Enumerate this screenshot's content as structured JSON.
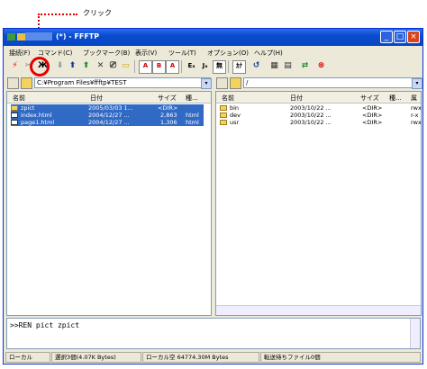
{
  "annotation": {
    "label": "クリック"
  },
  "window": {
    "title": "(*) - FFFTP",
    "title_masked": "■■■■"
  },
  "menu": [
    "接続(F)",
    "コマンド(C)",
    "ブックマーク(B)",
    "表示(V)",
    "ツール(T)",
    "オプション(O)",
    "ヘルプ(H)"
  ],
  "toolbar": [
    "connect",
    "disconnect",
    "cut",
    "download",
    "upload",
    "mirror",
    "delete",
    "rename",
    "mkdir",
    "asc",
    "bin",
    "auto",
    "euc",
    "jis",
    "none",
    "kana",
    "refresh",
    "list",
    "detail",
    "sync",
    "stop"
  ],
  "toolbar_labels": {
    "e": "Eₐ",
    "j": "Jₐ",
    "none": "無",
    "kana": "ｶﾅ"
  },
  "local": {
    "path": "C:¥Program Files¥ffftp¥TEST",
    "columns": [
      "名前",
      "日付",
      "サイズ",
      "種..."
    ],
    "files": [
      {
        "name": "zpict",
        "date": "2005/03/03 1...",
        "size": "<DIR>",
        "type": "",
        "kind": "folder"
      },
      {
        "name": "index.html",
        "date": "2004/12/27 ...",
        "size": "2,863",
        "type": "html",
        "kind": "doc"
      },
      {
        "name": "page1.html",
        "date": "2004/12/27 ...",
        "size": "1,306",
        "type": "html",
        "kind": "doc"
      }
    ]
  },
  "remote": {
    "path": "/",
    "columns": [
      "名前",
      "日付",
      "サイズ",
      "種...",
      "属"
    ],
    "files": [
      {
        "name": "bin",
        "date": "2003/10/22 ...",
        "size": "<DIR>",
        "type": "",
        "attr": "rwx"
      },
      {
        "name": "dev",
        "date": "2003/10/22 ...",
        "size": "<DIR>",
        "type": "",
        "attr": "r-x"
      },
      {
        "name": "usr",
        "date": "2003/10/22 ...",
        "size": "<DIR>",
        "type": "",
        "attr": "rwx"
      }
    ]
  },
  "log": {
    "text": ">>REN pict zpict"
  },
  "status": {
    "mode": "ローカル",
    "selected": "選択3個(4.07K Bytes)",
    "free": "ローカル空 64774.30M Bytes",
    "queue": "転送待ちファイル0個"
  },
  "colors": {
    "title": "#0a4ccf",
    "select": "#316ac5",
    "annotation": "#e30000"
  }
}
